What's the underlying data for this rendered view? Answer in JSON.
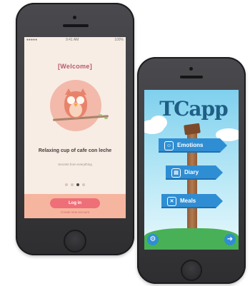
{
  "left_phone": {
    "status": {
      "carrier": "●●●●●",
      "time": "9:41 AM",
      "battery": "100%"
    },
    "welcome_title": "[Welcome]",
    "intro_title": "Relaxing cup of cafe con leche",
    "intro_subtitle": "Secrets from everything",
    "pager": {
      "count": 4,
      "active_index": 2
    },
    "login_button": "Log in",
    "login_subtext": "Create new account"
  },
  "right_phone": {
    "app_logo": "TCapp",
    "signs": [
      {
        "label": "Emotions",
        "icon": "smile-icon",
        "glyph": "☺"
      },
      {
        "label": "Diary",
        "icon": "book-icon",
        "glyph": "▤"
      },
      {
        "label": "Meals",
        "icon": "utensils-icon",
        "glyph": "✕"
      }
    ],
    "settings_glyph": "⚙",
    "exit_glyph": "➜"
  }
}
